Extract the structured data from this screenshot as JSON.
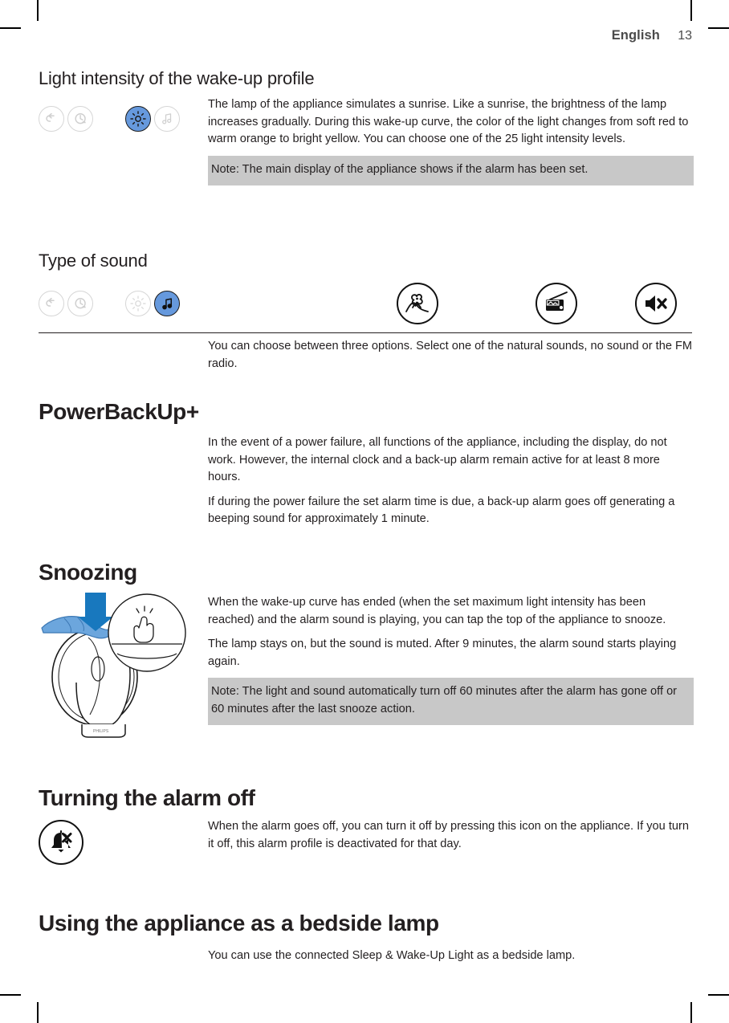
{
  "header": {
    "language": "English",
    "page_number": "13"
  },
  "sections": {
    "light_intensity": {
      "heading": "Light intensity of the wake-up profile",
      "body1": "The lamp of the appliance simulates a sunrise. Like a sunrise, the brightness of the lamp increases gradually. During this wake-up curve, the color of the light changes from soft red to warm orange to bright yellow. You can choose one of the 25 light intensity levels.",
      "note": "Note: The main display of the appliance shows if the alarm has been set.",
      "controls": [
        {
          "name": "back-icon",
          "label": "Back",
          "active": false
        },
        {
          "name": "alarm-clock-icon",
          "label": "Alarm time",
          "active": false
        },
        {
          "name": "brightness-icon",
          "label": "Light intensity",
          "active": true
        },
        {
          "name": "music-note-icon",
          "label": "Sound",
          "active": false
        }
      ]
    },
    "type_of_sound": {
      "heading": "Type of sound",
      "body1": "You can choose between three options. Select one of the natural sounds, no sound or the FM radio.",
      "controls": [
        {
          "name": "back-icon",
          "label": "Back",
          "active": false
        },
        {
          "name": "alarm-clock-icon",
          "label": "Alarm time",
          "active": false
        },
        {
          "name": "brightness-icon",
          "label": "Light intensity",
          "active": false
        },
        {
          "name": "music-note-icon",
          "label": "Sound",
          "active": true
        }
      ],
      "options": [
        {
          "name": "nature-sound-icon",
          "label": "Natural sounds"
        },
        {
          "name": "fm-radio-icon",
          "label": "FM radio"
        },
        {
          "name": "mute-icon",
          "label": "No sound"
        }
      ]
    },
    "powerbackup": {
      "heading": "PowerBackUp+",
      "body1": "In the event of a power failure, all functions of the appliance, including the display, do not work. However, the internal clock and a back-up alarm remain active for at least 8 more hours.",
      "body2": "If during the power failure the set alarm time is due, a back-up alarm goes off generating a beeping sound for approximately 1 minute."
    },
    "snoozing": {
      "heading": "Snoozing",
      "body1": "When the wake-up curve has ended (when the set maximum light intensity has been reached) and the alarm sound is playing, you can tap the top of the appliance to snooze.",
      "body2": "The lamp stays on, but the sound is muted. After 9 minutes, the alarm sound starts playing again.",
      "note": "Note: The light and sound automatically turn off 60 minutes after the alarm has gone off or 60 minutes after the last snooze action.",
      "illustration": {
        "name": "tap-to-snooze-illustration",
        "arrow_color": "#1878be",
        "hand_color": "#6ca6dd",
        "gesture_icon": "tap-hand-icon"
      }
    },
    "turning_alarm_off": {
      "heading": "Turning the alarm off",
      "body1": "When the alarm goes off, you can turn it off by pressing this icon on the appliance. If you turn it off, this alarm profile is deactivated for that day.",
      "icon": {
        "name": "alarm-off-icon",
        "label": "Alarm off"
      }
    },
    "bedside_lamp": {
      "heading": "Using the appliance as a bedside lamp",
      "body1": "You can use the connected Sleep & Wake-Up Light as a bedside lamp."
    }
  },
  "colors": {
    "accent_blue": "#6699dd",
    "note_background": "#c8c8c8",
    "text": "#231f20"
  }
}
